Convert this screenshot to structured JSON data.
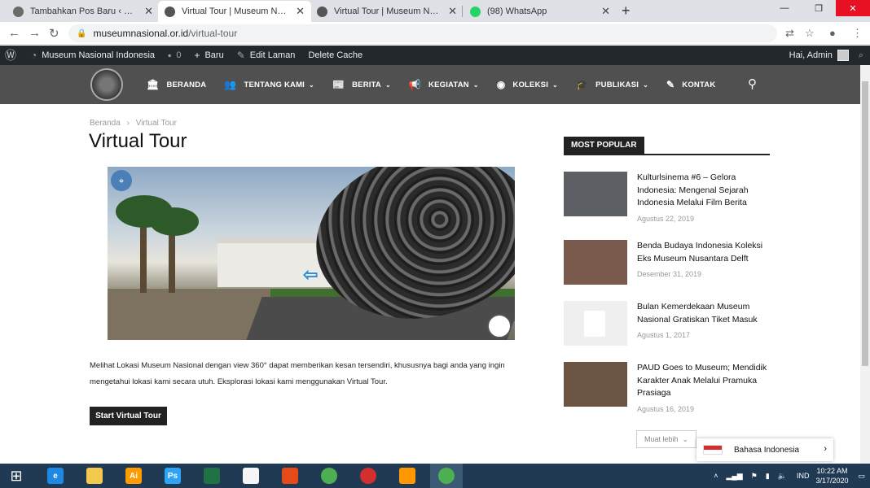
{
  "browser": {
    "tabs": [
      {
        "title": "Tambahkan Pos Baru ‹ Museum N",
        "favicon_color": "#6b6b6b",
        "active": false
      },
      {
        "title": "Virtual Tour | Museum Nasional I",
        "favicon_color": "#555555",
        "active": true
      },
      {
        "title": "Virtual Tour | Museum Nasional I",
        "favicon_color": "#555555",
        "active": false
      },
      {
        "title": "(98) WhatsApp",
        "favicon_color": "#25d366",
        "active": false
      }
    ],
    "close_glyph": "✕",
    "newtab_glyph": "+",
    "url_host": "museumnasional.or.id",
    "url_path": "/virtual-tour"
  },
  "adminbar": {
    "site_name": "Museum Nasional Indonesia",
    "comments_count": "0",
    "new_label": "Baru",
    "edit_label": "Edit Laman",
    "cache_label": "Delete Cache",
    "greeting": "Hai, Admin"
  },
  "menu": [
    {
      "label": "BERANDA",
      "icon": "bank-icon",
      "glyph": "🏛",
      "dropdown": false
    },
    {
      "label": "TENTANG KAMI",
      "icon": "users-icon",
      "glyph": "👥",
      "dropdown": true
    },
    {
      "label": "BERITA",
      "icon": "newspaper-icon",
      "glyph": "📰",
      "dropdown": true
    },
    {
      "label": "KEGIATAN",
      "icon": "megaphone-icon",
      "glyph": "📢",
      "dropdown": true
    },
    {
      "label": "KOLEKSI",
      "icon": "target-icon",
      "glyph": "◉",
      "dropdown": true
    },
    {
      "label": "PUBLIKASI",
      "icon": "graduation-cap-icon",
      "glyph": "🎓",
      "dropdown": true
    },
    {
      "label": "KONTAK",
      "icon": "edit-icon",
      "glyph": "✎",
      "dropdown": false
    }
  ],
  "breadcrumb": {
    "home": "Beranda",
    "separator": "›",
    "current": "Virtual Tour"
  },
  "page": {
    "title": "Virtual Tour",
    "description": "Melihat Lokasi Museum Nasional dengan view 360° dapat memberikan kesan tersendiri, khususnya bagi anda yang ingin mengetahui lokasi kami secara utuh. Eksplorasi lokasi kami menggunakan Virtual Tour.",
    "button_label": "Start Virtual Tour"
  },
  "sidebar": {
    "heading": "MOST POPULAR",
    "posts": [
      {
        "title": "Kulturlsinema #6 – Gelora Indonesia: Mengenal Sejarah Indonesia Melalui Film Berita",
        "date": "Agustus 22, 2019",
        "thumb_color": "#5c5f63"
      },
      {
        "title": "Benda Budaya Indonesia Koleksi Eks Museum Nusantara Delft",
        "date": "Desember 31, 2019",
        "thumb_color": "#7a5a4c"
      },
      {
        "title": "Bulan Kemerdekaan Museum Nasional Gratiskan Tiket Masuk",
        "date": "Agustus 1, 2017",
        "thumb_color": "#efefef"
      },
      {
        "title": "PAUD Goes to Museum; Mendidik Karakter Anak Melalui Pramuka Prasiaga",
        "date": "Agustus 16, 2019",
        "thumb_color": "#6b5542"
      }
    ],
    "more_label": "Muat lebih",
    "language": "Bahasa Indonesia"
  },
  "taskbar": {
    "apps": [
      {
        "name": "internet-explorer",
        "label": "e",
        "color": "#1e88e5"
      },
      {
        "name": "file-explorer",
        "label": "",
        "color": "#f2c94c"
      },
      {
        "name": "illustrator",
        "label": "Ai",
        "color": "#ff9a00"
      },
      {
        "name": "photoshop",
        "label": "Ps",
        "color": "#2fa4f7"
      },
      {
        "name": "excel",
        "label": "",
        "color": "#1f7244"
      },
      {
        "name": "notepad",
        "label": "",
        "color": "#f5f5f5"
      },
      {
        "name": "wps-presentation",
        "label": "",
        "color": "#e64a19"
      },
      {
        "name": "chrome",
        "label": "",
        "color": "#4caf50"
      },
      {
        "name": "opera",
        "label": "",
        "color": "#d32f2f"
      },
      {
        "name": "media-player",
        "label": "",
        "color": "#ff9800"
      },
      {
        "name": "chrome-active",
        "label": "",
        "color": "#4caf50"
      }
    ],
    "lang": "IND",
    "time": "10:22 AM",
    "date": "3/17/2020"
  }
}
